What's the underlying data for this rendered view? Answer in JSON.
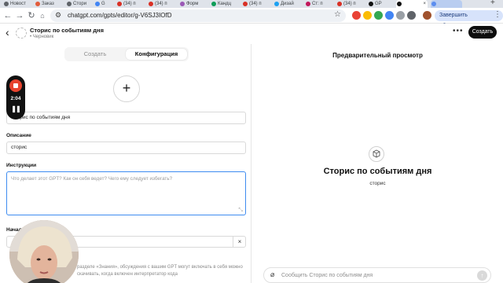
{
  "browser": {
    "tabs": [
      {
        "label": "Новост",
        "active": false
      },
      {
        "label": "Заказ",
        "active": false
      },
      {
        "label": "Стори",
        "active": false
      },
      {
        "label": "G",
        "active": false
      },
      {
        "label": "(34) п",
        "active": false
      },
      {
        "label": "(34) п",
        "active": false
      },
      {
        "label": "Форм",
        "active": false
      },
      {
        "label": "Кандц",
        "active": false
      },
      {
        "label": "(34) п",
        "active": false
      },
      {
        "label": "Дизай",
        "active": false
      },
      {
        "label": "Ст: п",
        "active": false
      },
      {
        "label": "(34) п",
        "active": false
      },
      {
        "label": "GP",
        "active": false
      },
      {
        "label": "",
        "active": true
      }
    ],
    "url": "chatgpt.com/gpts/editor/g-V6SJ3IOfD",
    "update_label": "Завершить обновление"
  },
  "header": {
    "title": "Сторис по событиям дня",
    "status": "• Черновик",
    "more_label": "•••",
    "create_label": "Создать"
  },
  "editor": {
    "tabs": [
      {
        "label": "Создать",
        "active": false
      },
      {
        "label": "Конфигурация",
        "active": true
      }
    ],
    "name_value": "Сторис по событиям дня",
    "description_label": "Описание",
    "description_value": "сторис",
    "instructions_label": "Инструкции",
    "instructions_placeholder": "Что делает этот GPT? Как он себя ведет? Чего ему следует избегать?",
    "starters_label": "Начал",
    "knowledge_text": "разделе «Знания», обсуждения с вашим GPT могут включать в себя можно скачивать, когда включен интерпретатор кода"
  },
  "recorder": {
    "time": "2:04"
  },
  "preview": {
    "title": "Предварительный просмотр",
    "gpt_name": "Сторис по событиям дня",
    "gpt_description": "сторис",
    "message_placeholder": "Сообщить Сторис по событиям дня"
  },
  "colors": {
    "accent_blue": "#3e8cf0",
    "record_red": "#e8442e",
    "button_dark": "#0d0d0d"
  }
}
